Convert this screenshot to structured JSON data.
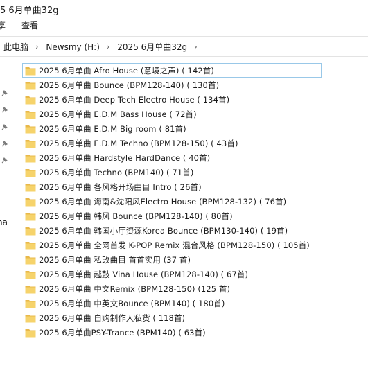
{
  "window": {
    "title": "5 6月单曲32g"
  },
  "ribbon": {
    "tab_cut": "享",
    "tab_view": "查看"
  },
  "address": {
    "crumbs": [
      "此电脑",
      "Newsmy (H:)",
      "2025 6月单曲32g"
    ]
  },
  "nav": {
    "partial_label": "na"
  },
  "files": [
    "2025 6月单曲 Afro House (意境之声) ( 142首)",
    "2025 6月单曲 Bounce (BPM128-140) ( 130首)",
    "2025 6月单曲 Deep Tech Electro House ( 134首)",
    "2025 6月单曲 E.D.M Bass House ( 72首)",
    "2025 6月单曲 E.D.M Big room ( 81首)",
    "2025 6月单曲 E.D.M Techno (BPM128-150) ( 43首)",
    "2025 6月单曲 Hardstyle HardDance ( 40首)",
    "2025 6月单曲 Techno (BPM140) ( 71首)",
    "2025 6月单曲 各风格开场曲目 Intro ( 26首)",
    "2025 6月单曲 海南&沈阳风Electro House (BPM128-132) ( 76首)",
    "2025 6月单曲 韩风 Bounce (BPM128-140) ( 80首)",
    "2025 6月单曲 韩国小厅资源Korea Bounce (BPM130-140) ( 19首)",
    "2025 6月单曲 全网首发 K-POP Remix 混合风格 (BPM128-150) ( 105首)",
    "2025 6月单曲 私改曲目 首首实用 (37 首)",
    "2025 6月单曲 越鼓 Vina House (BPM128-140) ( 67首)",
    "2025 6月单曲 中文Remix (BPM128-150) (125 首)",
    "2025 6月单曲 中英文Bounce (BPM140) ( 180首)",
    "2025 6月单曲 自购制作人私货 ( 118首)",
    "2025 6月单曲PSY-Trance (BPM140) ( 63首)"
  ],
  "colors": {
    "folder_fill": "#f6d36b",
    "folder_dark": "#e8b84a",
    "focus_border": "#99c8e8"
  }
}
